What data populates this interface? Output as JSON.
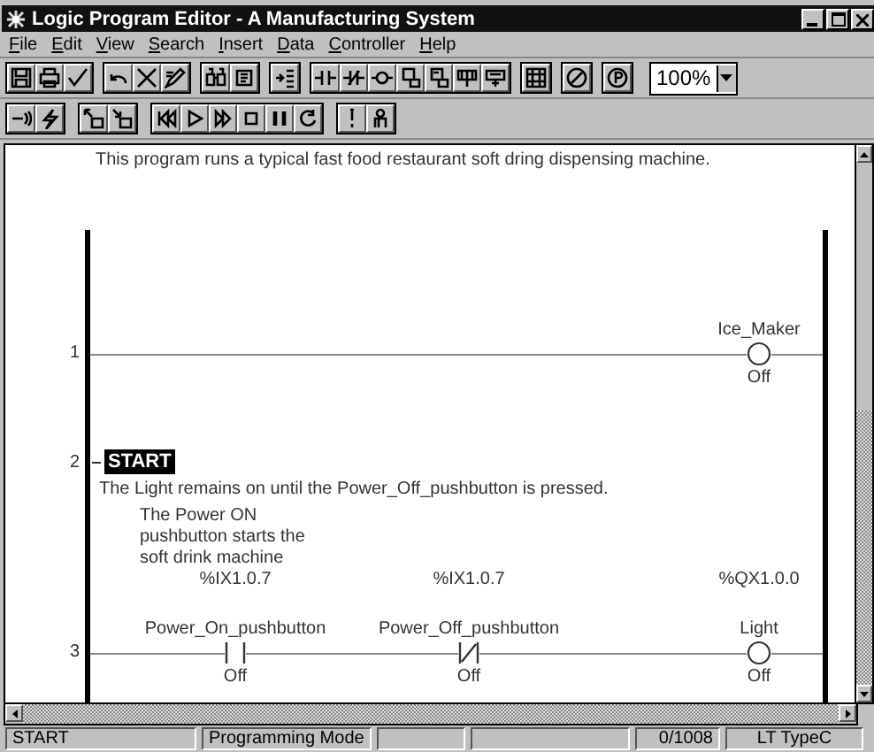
{
  "window": {
    "title": "Logic Program Editor - A Manufacturing System"
  },
  "menu": [
    "File",
    "Edit",
    "View",
    "Search",
    "Insert",
    "Data",
    "Controller",
    "Help"
  ],
  "toolbar": {
    "zoom": "100%"
  },
  "program": {
    "description": "This program runs a typical fast food restaurant soft dring dispensing machine.",
    "rungs": [
      {
        "number": "1",
        "kind": "rung",
        "elements": [
          {
            "kind": "coil",
            "name": "Ice_Maker",
            "state": "Off"
          }
        ]
      },
      {
        "number": "2",
        "kind": "label",
        "label": "START",
        "comment": "The Light remains on until the Power_Off_pushbutton is pressed."
      },
      {
        "number": "3",
        "kind": "rung",
        "elements": [
          {
            "kind": "contact",
            "description": "The Power ON\npushbutton starts the\nsoft drink machine",
            "address": "%IX1.0.7",
            "name": "Power_On_pushbutton",
            "state": "Off"
          },
          {
            "kind": "contact_nc",
            "address": "%IX1.0.7",
            "name": "Power_Off_pushbutton",
            "state": "Off"
          },
          {
            "kind": "coil",
            "address": "%QX1.0.0",
            "name": "Light",
            "state": "Off"
          }
        ]
      }
    ]
  },
  "status_bar": [
    {
      "kind": "text",
      "text": "START"
    },
    {
      "kind": "text",
      "text": "Programming Mode"
    },
    {
      "kind": "empty"
    },
    {
      "kind": "empty"
    },
    {
      "kind": "text",
      "text": "0/1008"
    },
    {
      "kind": "text",
      "text": "LT TypeC"
    }
  ]
}
